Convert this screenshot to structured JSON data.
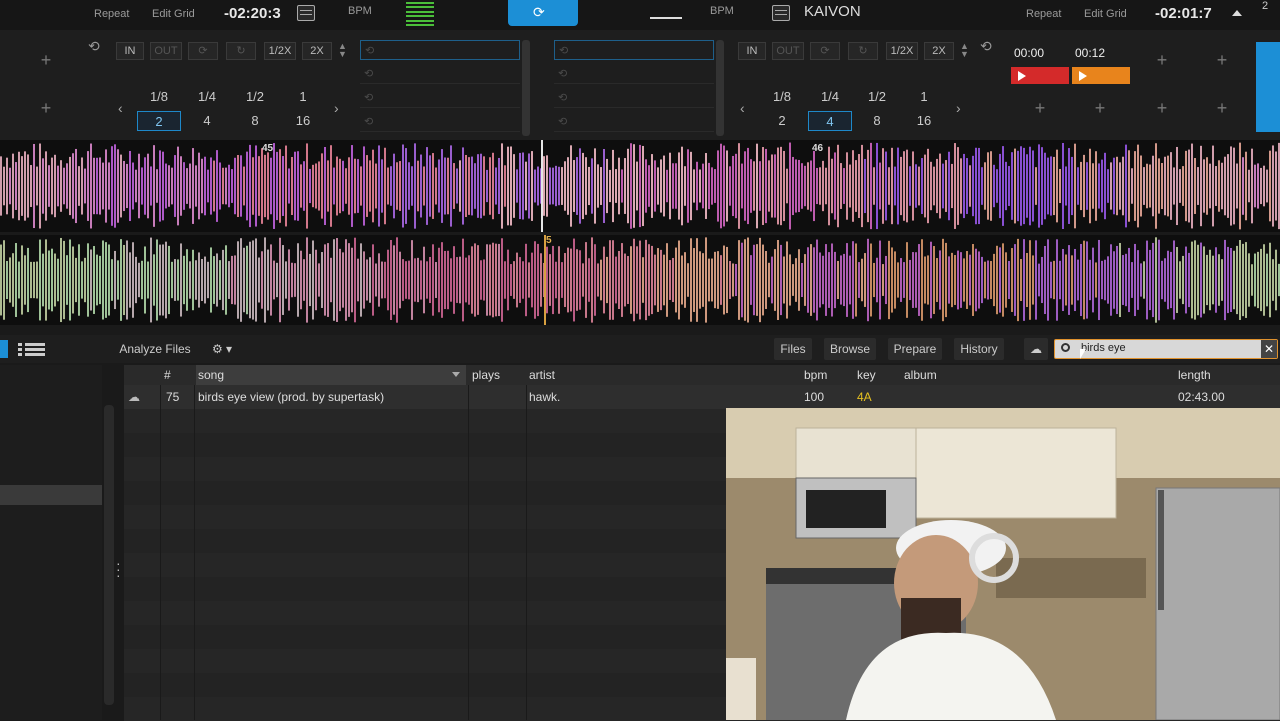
{
  "top": {
    "left_repeat": "Repeat",
    "left_edit_grid": "Edit Grid",
    "left_time": "-02:20:3",
    "left_bpm": "BPM",
    "right_bpm": "BPM",
    "right_artist": "KAIVON",
    "right_repeat": "Repeat",
    "right_edit_grid": "Edit Grid",
    "right_time": "-02:01:7",
    "corner_number": "2"
  },
  "deck_left": {
    "loop_in": "IN",
    "loop_out": "OUT",
    "half": "1/2X",
    "double": "2X",
    "beats_row1": [
      "1/8",
      "1/4",
      "1/2",
      "1"
    ],
    "beats_row2": [
      "2",
      "4",
      "8",
      "16"
    ],
    "selected_beat": "2"
  },
  "deck_right": {
    "loop_in": "IN",
    "loop_out": "OUT",
    "half": "1/2X",
    "double": "2X",
    "beats_row1": [
      "1/8",
      "1/4",
      "1/2",
      "1"
    ],
    "beats_row2": [
      "2",
      "4",
      "8",
      "16"
    ],
    "selected_beat": "4",
    "cue_times": [
      "00:00",
      "00:12"
    ],
    "cue_colors": [
      "#d42a2a",
      "#e8841c"
    ]
  },
  "waveform": {
    "marker_top_left": "45",
    "marker_top_right": "46",
    "marker_bottom": "5"
  },
  "browser": {
    "analyze_files": "Analyze Files",
    "tabs": [
      "Files",
      "Browse",
      "Prepare",
      "History"
    ],
    "search_value": "birds eye",
    "columns": {
      "num": "#",
      "song": "song",
      "plays": "plays",
      "artist": "artist",
      "bpm": "bpm",
      "key": "key",
      "album": "album",
      "length": "length"
    },
    "tracks": [
      {
        "num": "75",
        "song": "birds eye view (prod. by supertask)",
        "plays": "",
        "artist": "hawk.",
        "bpm": "100",
        "key": "4A",
        "album": "",
        "length": "02:43.00"
      }
    ]
  },
  "colors": {
    "accent_blue": "#1c8fd6",
    "key_yellow": "#e6c020",
    "search_border": "#e0922e"
  }
}
